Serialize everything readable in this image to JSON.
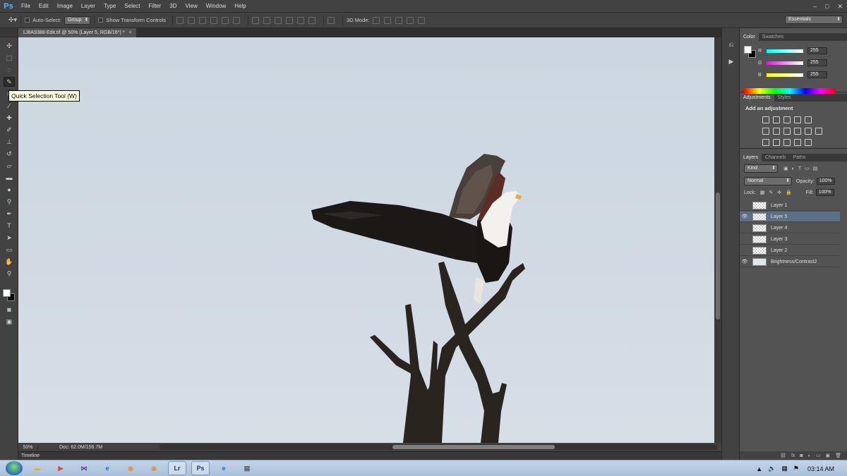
{
  "app": {
    "logo": "Ps"
  },
  "menu": [
    "File",
    "Edit",
    "Image",
    "Layer",
    "Type",
    "Select",
    "Filter",
    "3D",
    "View",
    "Window",
    "Help"
  ],
  "window_controls": {
    "minimize": "–",
    "maximize": "□",
    "close": "✕"
  },
  "options": {
    "auto_select_label": "Auto-Select:",
    "auto_select_value": "Group",
    "transform_label": "Show Transform Controls",
    "mode_3d_label": "3D Mode:",
    "workspace": "Essentials"
  },
  "document": {
    "tab_title": "1J8A9388-Edit.tif @ 50% (Layer 5, RGB/16*) *",
    "close": "×",
    "zoom": "50%",
    "doc_info": "Doc: 62.0M/156.7M"
  },
  "tooltip": "Quick Selection Tool (W)",
  "timeline_label": "Timeline",
  "color_panel": {
    "tabs": [
      "Color",
      "Swatches"
    ],
    "r_label": "R",
    "g_label": "G",
    "b_label": "B",
    "r": "255",
    "g": "255",
    "b": "255"
  },
  "adjustments_panel": {
    "tabs": [
      "Adjustments",
      "Styles"
    ],
    "title": "Add an adjustment"
  },
  "layers_panel": {
    "tabs": [
      "Layers",
      "Channels",
      "Paths"
    ],
    "kind": "Kind",
    "blend_mode": "Normal",
    "opacity_label": "Opacity:",
    "opacity": "100%",
    "lock_label": "Lock:",
    "fill_label": "Fill:",
    "fill": "100%",
    "layers": [
      {
        "name": "Layer 1",
        "visible": false,
        "selected": false
      },
      {
        "name": "Layer 5",
        "visible": true,
        "selected": true
      },
      {
        "name": "Layer 4",
        "visible": false,
        "selected": false
      },
      {
        "name": "Layer 3",
        "visible": false,
        "selected": false
      },
      {
        "name": "Layer 2",
        "visible": false,
        "selected": false
      },
      {
        "name": "Brightness/Contrast2",
        "visible": true,
        "selected": false
      }
    ]
  },
  "taskbar": {
    "apps": [
      "explorer-icon",
      "media-icon",
      "visual-studio-icon",
      "ie-icon",
      "chrome-icon",
      "chrome-icon",
      "lightroom-icon",
      "photoshop-icon",
      "ie-icon",
      "printer-icon"
    ],
    "lightroom_label": "Lr",
    "photoshop_label": "Ps",
    "clock": "03:14 AM"
  }
}
